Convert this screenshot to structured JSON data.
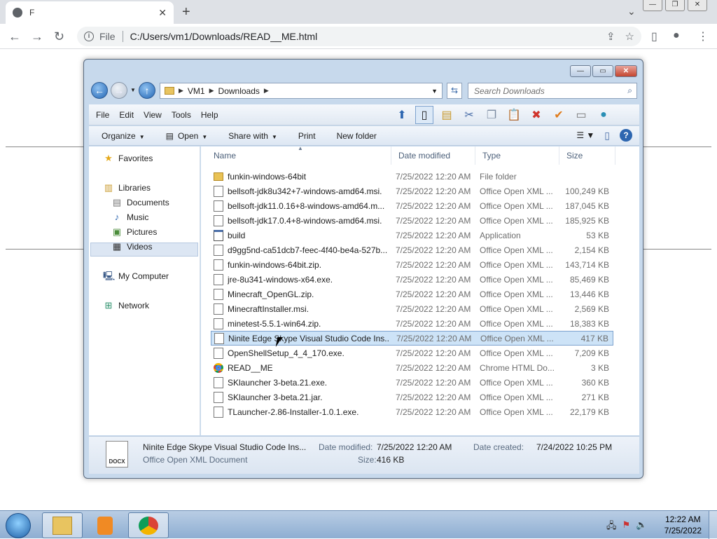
{
  "browser": {
    "tab_title": "F",
    "tab_close": "✕",
    "new_tab": "+",
    "omnibox_scheme": "File",
    "url": "C:/Users/vm1/Downloads/READ__ME.html"
  },
  "explorer": {
    "breadcrumb": [
      "VM1",
      "Downloads"
    ],
    "search_placeholder": "Search Downloads",
    "menu": [
      "File",
      "Edit",
      "View",
      "Tools",
      "Help"
    ],
    "commands": {
      "organize": "Organize",
      "open": "Open",
      "share_with": "Share with",
      "print": "Print",
      "new_folder": "New folder"
    },
    "nav": {
      "favorites": "Favorites",
      "libraries": "Libraries",
      "documents": "Documents",
      "music": "Music",
      "pictures": "Pictures",
      "videos": "Videos",
      "my_computer": "My Computer",
      "network": "Network"
    },
    "columns": {
      "name": "Name",
      "date_modified": "Date modified",
      "type": "Type",
      "size": "Size"
    },
    "files": [
      {
        "name": "funkin-windows-64bit",
        "date": "7/25/2022 12:20 AM",
        "type": "File folder",
        "size": "",
        "icon": "folder-icon"
      },
      {
        "name": "bellsoft-jdk8u342+7-windows-amd64.msi.",
        "date": "7/25/2022 12:20 AM",
        "type": "Office Open XML ...",
        "size": "100,249 KB",
        "icon": "document-icon"
      },
      {
        "name": "bellsoft-jdk11.0.16+8-windows-amd64.m...",
        "date": "7/25/2022 12:20 AM",
        "type": "Office Open XML ...",
        "size": "187,045 KB",
        "icon": "document-icon"
      },
      {
        "name": "bellsoft-jdk17.0.4+8-windows-amd64.msi.",
        "date": "7/25/2022 12:20 AM",
        "type": "Office Open XML ...",
        "size": "185,925 KB",
        "icon": "document-icon"
      },
      {
        "name": "build",
        "date": "7/25/2022 12:20 AM",
        "type": "Application",
        "size": "53 KB",
        "icon": "application-icon"
      },
      {
        "name": "d9gg5nd-ca51dcb7-feec-4f40-be4a-527b...",
        "date": "7/25/2022 12:20 AM",
        "type": "Office Open XML ...",
        "size": "2,154 KB",
        "icon": "document-icon"
      },
      {
        "name": "funkin-windows-64bit.zip.",
        "date": "7/25/2022 12:20 AM",
        "type": "Office Open XML ...",
        "size": "143,714 KB",
        "icon": "document-icon"
      },
      {
        "name": "jre-8u341-windows-x64.exe.",
        "date": "7/25/2022 12:20 AM",
        "type": "Office Open XML ...",
        "size": "85,469 KB",
        "icon": "document-icon"
      },
      {
        "name": "Minecraft_OpenGL.zip.",
        "date": "7/25/2022 12:20 AM",
        "type": "Office Open XML ...",
        "size": "13,446 KB",
        "icon": "document-icon"
      },
      {
        "name": "MinecraftInstaller.msi.",
        "date": "7/25/2022 12:20 AM",
        "type": "Office Open XML ...",
        "size": "2,569 KB",
        "icon": "document-icon"
      },
      {
        "name": "minetest-5.5.1-win64.zip.",
        "date": "7/25/2022 12:20 AM",
        "type": "Office Open XML ...",
        "size": "18,383 KB",
        "icon": "document-icon"
      },
      {
        "name": "Ninite Edge Skype Visual Studio Code Ins...",
        "date": "7/25/2022 12:20 AM",
        "type": "Office Open XML ...",
        "size": "417 KB",
        "icon": "document-icon",
        "selected": true
      },
      {
        "name": "OpenShellSetup_4_4_170.exe.",
        "date": "7/25/2022 12:20 AM",
        "type": "Office Open XML ...",
        "size": "7,209 KB",
        "icon": "document-icon"
      },
      {
        "name": "READ__ME",
        "date": "7/25/2022 12:20 AM",
        "type": "Chrome HTML Do...",
        "size": "3 KB",
        "icon": "chrome-icon"
      },
      {
        "name": "SKlauncher 3-beta.21.exe.",
        "date": "7/25/2022 12:20 AM",
        "type": "Office Open XML ...",
        "size": "360 KB",
        "icon": "document-icon"
      },
      {
        "name": "SKlauncher 3-beta.21.jar.",
        "date": "7/25/2022 12:20 AM",
        "type": "Office Open XML ...",
        "size": "271 KB",
        "icon": "document-icon"
      },
      {
        "name": "TLauncher-2.86-Installer-1.0.1.exe.",
        "date": "7/25/2022 12:20 AM",
        "type": "Office Open XML ...",
        "size": "22,179 KB",
        "icon": "document-icon"
      }
    ],
    "details": {
      "icon_text": "DOCX",
      "name": "Ninite Edge Skype Visual Studio Code Ins...",
      "type": "Office Open XML Document",
      "date_modified_label": "Date modified:",
      "date_modified": "7/25/2022 12:20 AM",
      "size_label": "Size:",
      "size": "416 KB",
      "date_created_label": "Date created:",
      "date_created": "7/24/2022 10:25 PM"
    }
  },
  "taskbar": {
    "time": "12:22 AM",
    "date": "7/25/2022"
  }
}
